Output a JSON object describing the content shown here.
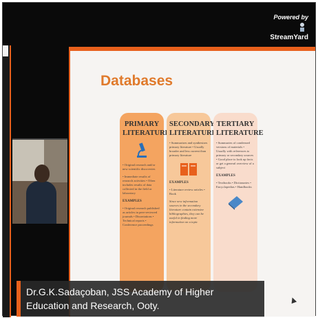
{
  "branding": {
    "powered_by": "Powered by",
    "brand_name": "StreamYard"
  },
  "slide": {
    "title": "Databases",
    "columns": [
      {
        "title_line1": "PRIMARY",
        "title_line2": "LITERATURE",
        "bullets": "• Original research and/or new scientific discoveries",
        "details": "• Immediate results of research activities • Often includes results of data collected in the field or laboratory",
        "examples_label": "EXAMPLES",
        "examples": "• Original research published as articles in peer-reviewed journals • Dissertations • Technical reports • Conference proceedings",
        "icon": "microscope-icon"
      },
      {
        "title_line1": "SECONDARY",
        "title_line2": "LITERATURE",
        "bullets": "• Summarizes and synthesizes primary literature • Usually broader and less current than primary literature",
        "examples_label": "EXAMPLES",
        "examples": "• Literature review articles • Book",
        "details": "Since new information sources in the secondary literature contain extensive bibliographies, they can be useful in finding more information on a topic",
        "icon": "book-icon"
      },
      {
        "title_line1": "TERTIARY",
        "title_line2": "LITERATURE",
        "bullets": "• Summaries of condensed versions of materials • Usually with references to primary or secondary sources • Good place to look up facts or get a general overview of a subject",
        "examples_label": "EXAMPLES",
        "examples": "• Textbooks • Dictionaries • Encyclopedias • Handbooks",
        "icon": "closed-book-icon"
      }
    ]
  },
  "caption": {
    "text": "Dr.G.K.Sadaçoban, JSS Academy of Higher Education and Research, Ooty."
  },
  "colors": {
    "accent": "#e8601c",
    "title": "#e07a2c",
    "primary_col": "#f4a460",
    "secondary_col": "#f7c89a",
    "tertiary_col": "#f9dccc"
  }
}
